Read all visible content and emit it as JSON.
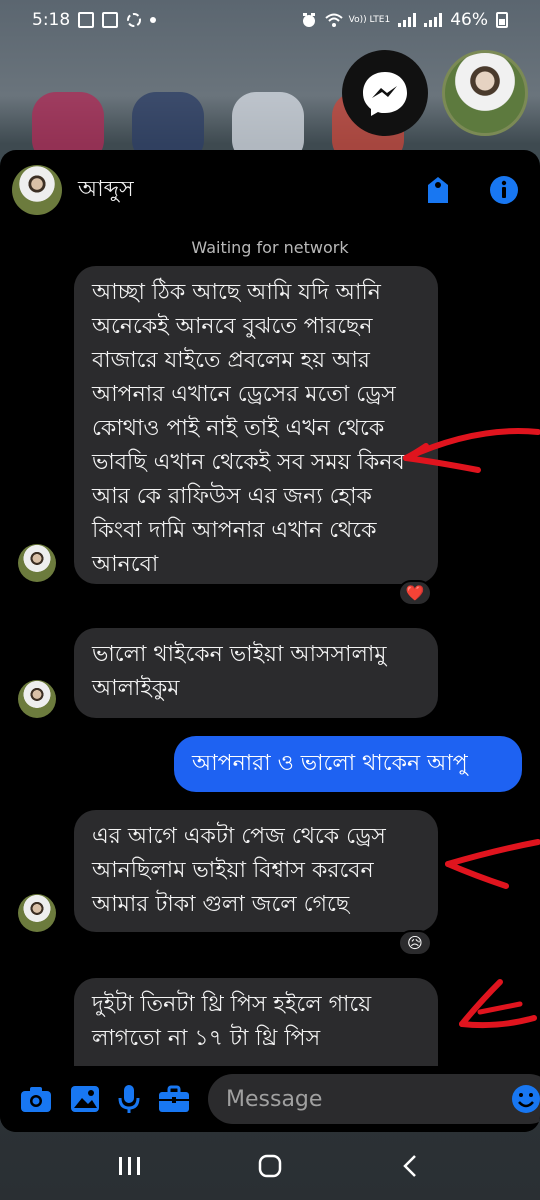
{
  "status_bar": {
    "time": "5:18",
    "network_label": "Vo)) LTE1",
    "battery": "46%"
  },
  "chat": {
    "contact_name": "আব্দুস",
    "network_status": "Waiting for network",
    "messages": [
      {
        "direction": "in",
        "text": "আচ্ছা ঠিক আছে আমি যদি আনি অনেকেই আনবে বুঝতে পারছেন বাজারে যাইতে প্রবলেম হয় আর আপনার এখানে ড্রেসের মতো ড্রেস কোথাও পাই নাই তাই এখন থেকে ভাবছি এখান থেকেই সব সময় কিনব আর কে রাফিউস এর জন্য হোক কিংবা দামি আপনার এখান থেকে আনবো",
        "reaction": "❤️"
      },
      {
        "direction": "in",
        "text": "ভালো থাইকেন ভাইয়া আসসালামু আলাইকুম"
      },
      {
        "direction": "out",
        "text": "আপনারা ও  ভালো থাকেন আপু"
      },
      {
        "direction": "in",
        "text": "এর আগে একটা পেজ থেকে ড্রেস আনছিলাম ভাইয়া বিশ্বাস করবেন আমার টাকা গুলা জলে গেছে",
        "reaction": "😥"
      },
      {
        "direction": "in",
        "text": "দুইটা তিনটা থ্রি পিস হইলে গায়ে লাগতো না ১৭ টা থ্রি পিস"
      }
    ]
  },
  "composer": {
    "placeholder": "Message"
  },
  "colors": {
    "accent": "#1e62f2",
    "incoming_bubble": "#2b2b2d",
    "arrow": "#e0141e"
  }
}
